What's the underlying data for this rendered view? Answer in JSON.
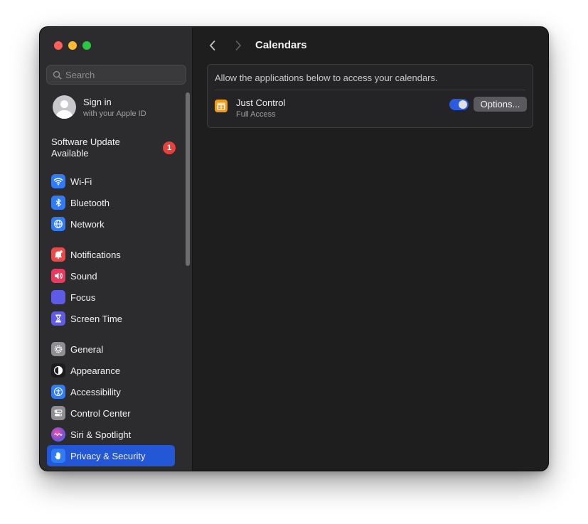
{
  "window": {
    "traffic_lights": {
      "close": "#fe5f57",
      "minimize": "#febc2e",
      "maximize": "#28c840"
    }
  },
  "sidebar": {
    "search": {
      "placeholder": "Search",
      "value": ""
    },
    "account": {
      "title": "Sign in",
      "subtitle": "with your Apple ID"
    },
    "software_update": {
      "label": "Software Update Available",
      "badge": "1"
    },
    "items": [
      {
        "label": "Wi-Fi",
        "icon": "wifi-icon",
        "color": "#2f7cf6"
      },
      {
        "label": "Bluetooth",
        "icon": "bluetooth-icon",
        "color": "#2f7cf6"
      },
      {
        "label": "Network",
        "icon": "globe-icon",
        "color": "#2f7cf6"
      },
      {
        "label": "Notifications",
        "icon": "bell-icon",
        "color": "#ea4a4a"
      },
      {
        "label": "Sound",
        "icon": "speaker-icon",
        "color": "#e83a5e"
      },
      {
        "label": "Focus",
        "icon": "moon-icon",
        "color": "#5e5ce6"
      },
      {
        "label": "Screen Time",
        "icon": "hourglass-icon",
        "color": "#5e5ce6"
      },
      {
        "label": "General",
        "icon": "gear-icon",
        "color": "#8e8e93"
      },
      {
        "label": "Appearance",
        "icon": "appearance-icon",
        "color": "#1c1c1e"
      },
      {
        "label": "Accessibility",
        "icon": "accessibility-icon",
        "color": "#2f7cf6"
      },
      {
        "label": "Control Center",
        "icon": "switches-icon",
        "color": "#8e8e93"
      },
      {
        "label": "Siri & Spotlight",
        "icon": "siri-icon",
        "color": "#7b4fd6"
      },
      {
        "label": "Privacy & Security",
        "icon": "hand-icon",
        "color": "#2f7cf6",
        "selected": true
      }
    ],
    "selection_color": "#2457d6"
  },
  "main": {
    "title": "Calendars",
    "description": "Allow the applications below to access your calendars.",
    "apps": [
      {
        "name": "Just Control",
        "status": "Full Access",
        "icon": "calendar-app-icon",
        "icon_color": "#f09a1a",
        "enabled": true,
        "options_label": "Options..."
      }
    ]
  }
}
